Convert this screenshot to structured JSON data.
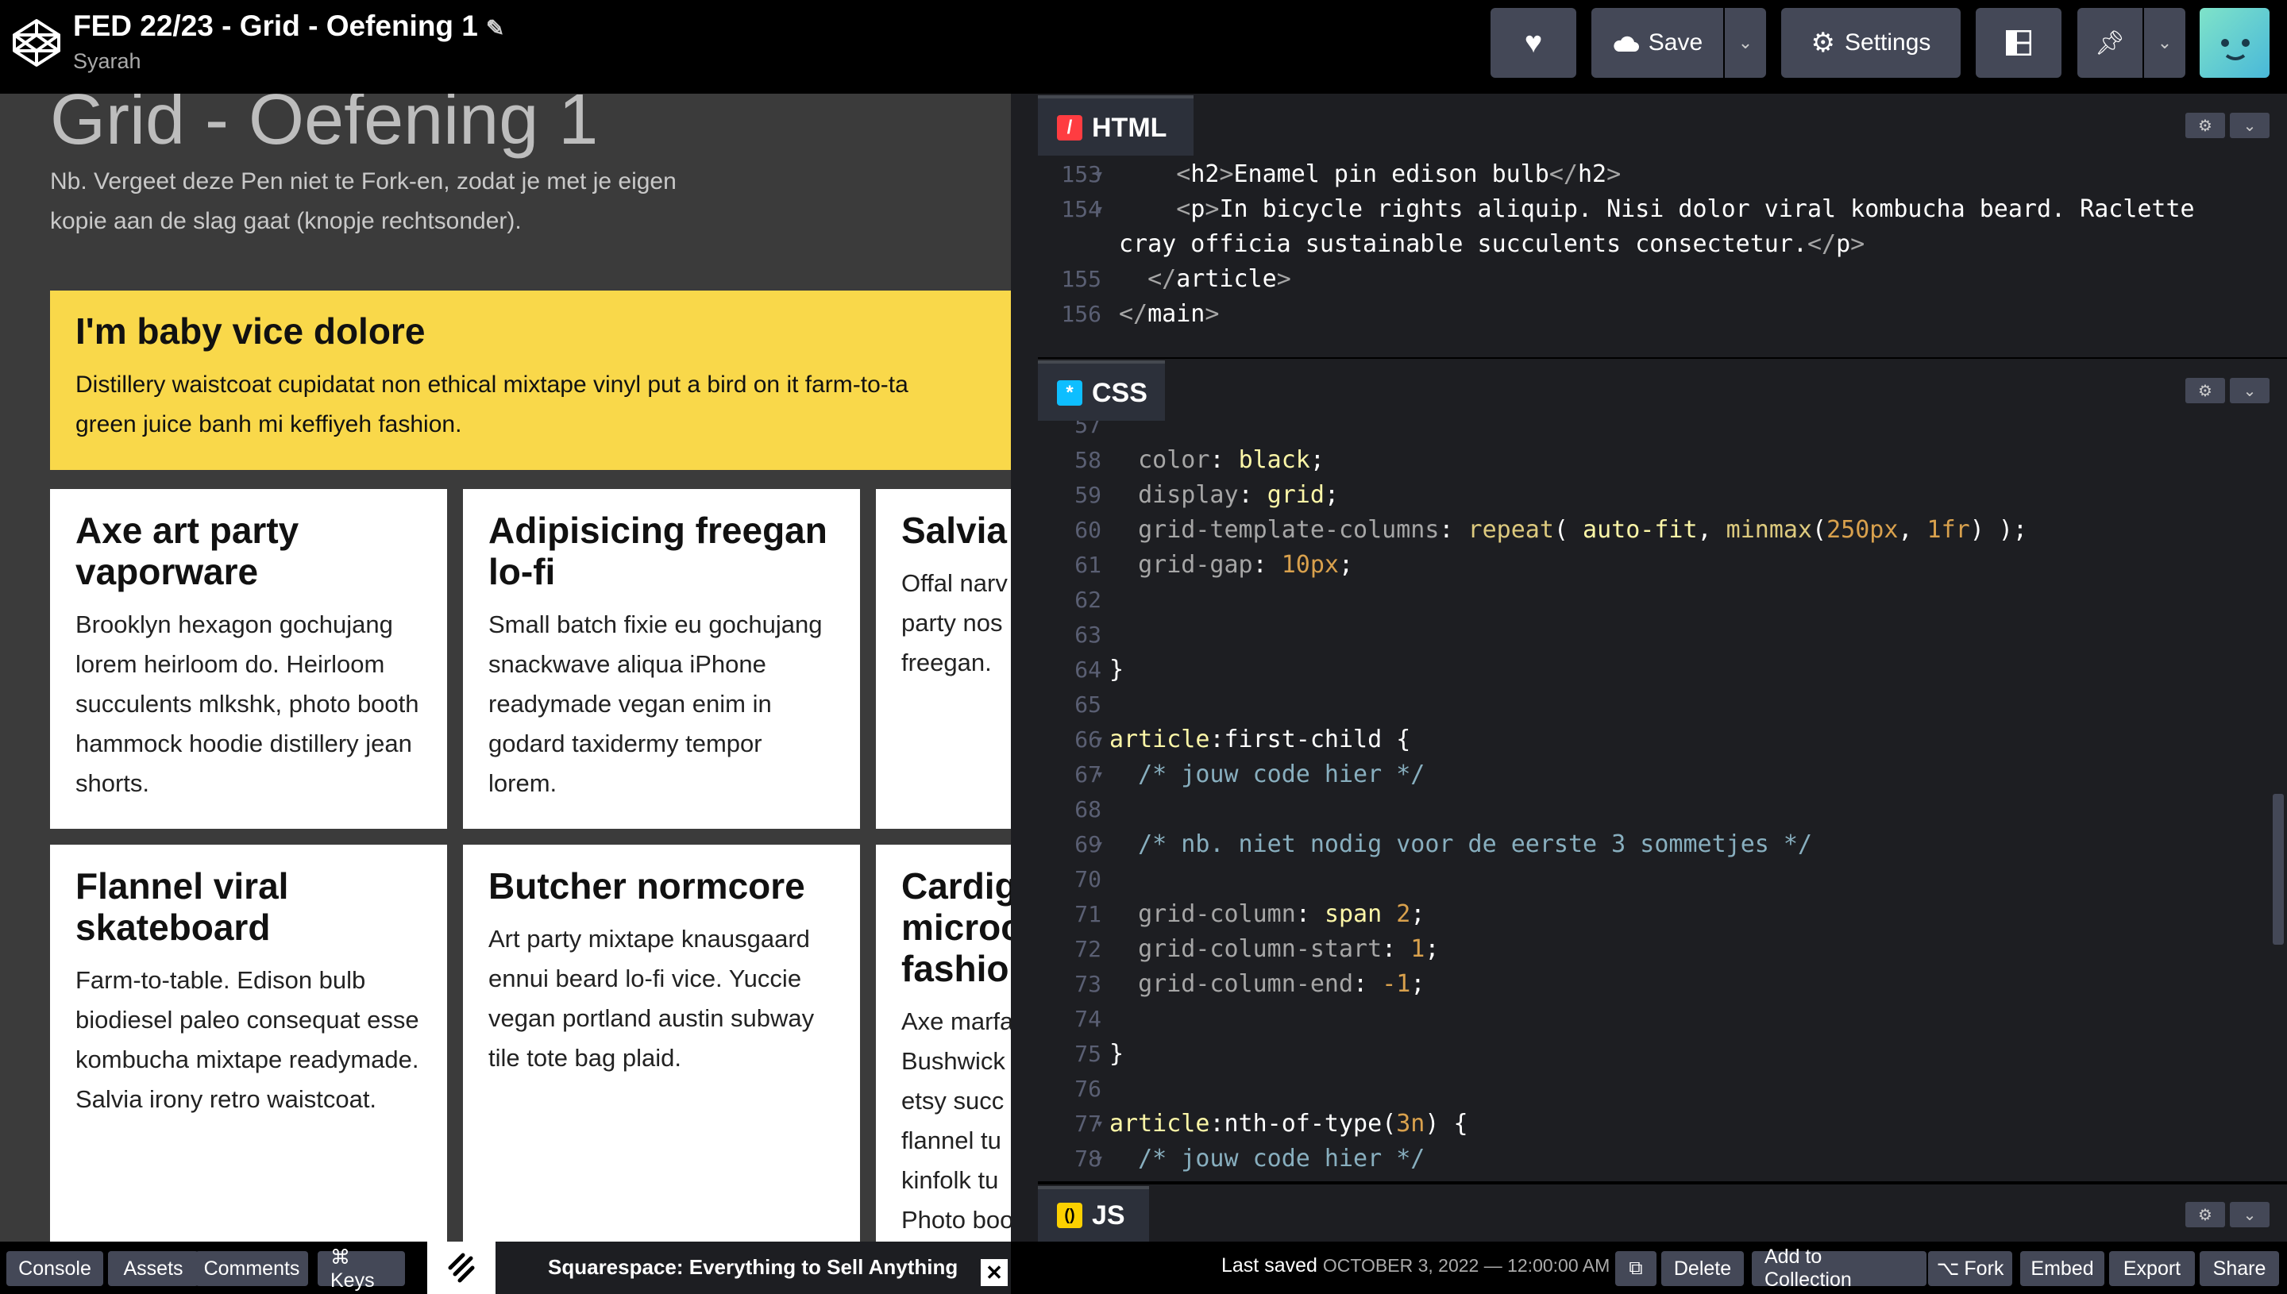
{
  "header": {
    "title": "FED 22/23 - Grid - Oefening 1",
    "author": "Syarah",
    "save_label": "Save",
    "settings_label": "Settings",
    "icons": [
      "codepen-logo-icon",
      "pencil-icon",
      "heart-icon",
      "cloud-icon",
      "chevron-down-icon",
      "gear-icon",
      "layout-icon",
      "pin-icon",
      "avatar"
    ]
  },
  "preview": {
    "heading": "Grid - Oefening 1",
    "note": "Nb. Vergeet deze Pen niet te Fork-en, zodat je met je eigen kopie aan de slag gaat (knopje rechtsonder).",
    "hero": {
      "title": "I'm baby vice dolore",
      "text1": "Distillery waistcoat cupidatat non ethical mixtape vinyl put a bird on it farm-to-ta",
      "text2": "green juice banh mi keffiyeh fashion."
    },
    "cards": [
      {
        "title": "Axe art party vaporware",
        "text": "Brooklyn hexagon gochujang lorem heirloom do. Heirloom succulents mlkshk, photo booth hammock hoodie distillery jean shorts."
      },
      {
        "title": "Adipisicing freegan lo-fi",
        "text": "Small batch fixie eu gochujang snackwave aliqua iPhone readymade vegan enim in godard taxidermy tempor lorem."
      },
      {
        "title": "Salvia",
        "text": "Offal narv party nos freegan."
      },
      {
        "title": "Flannel viral skateboard",
        "text": "Farm-to-table. Edison bulb biodiesel paleo consequat esse kombucha mixtape readymade. Salvia irony retro waistcoat."
      },
      {
        "title": "Butcher normcore",
        "text": "Art party mixtape knausgaard ennui beard lo-fi vice. Yuccie vegan portland austin subway tile tote bag plaid."
      },
      {
        "title": "Cardig microc fashio",
        "text": "Axe marfa Bushwick etsy succ flannel tu kinfolk tu Photo boo"
      }
    ]
  },
  "editor": {
    "html_tab": "HTML",
    "css_tab": "CSS",
    "js_tab": "JS",
    "html_lines": [
      {
        "n": "153",
        "fold": true,
        "indent": "    ",
        "parts": [
          [
            "tag",
            "<"
          ],
          [
            "tn",
            "h2"
          ],
          [
            "tag",
            ">"
          ],
          [
            "op",
            "Enamel pin edison bulb"
          ],
          [
            "tag",
            "</"
          ],
          [
            "tn",
            "h2"
          ],
          [
            "tag",
            ">"
          ]
        ]
      },
      {
        "n": "154",
        "fold": true,
        "indent": "    ",
        "parts": [
          [
            "tag",
            "<"
          ],
          [
            "tn",
            "p"
          ],
          [
            "tag",
            ">"
          ],
          [
            "op",
            "In bicycle rights aliquip. Nisi dolor viral kombucha beard. Raclette"
          ]
        ]
      },
      {
        "n": "",
        "fold": false,
        "indent": "",
        "parts": [
          [
            "op",
            "cray officia sustainable succulents consectetur."
          ],
          [
            "tag",
            "</"
          ],
          [
            "tn",
            "p"
          ],
          [
            "tag",
            ">"
          ]
        ]
      },
      {
        "n": "155",
        "fold": false,
        "indent": "  ",
        "parts": [
          [
            "tag",
            "</"
          ],
          [
            "tn",
            "article"
          ],
          [
            "tag",
            ">"
          ]
        ]
      },
      {
        "n": "156",
        "fold": false,
        "indent": "",
        "parts": [
          [
            "tag",
            "</"
          ],
          [
            "tn",
            "main"
          ],
          [
            "tag",
            ">"
          ]
        ]
      }
    ],
    "css_lines": [
      {
        "n": "57",
        "fold": false,
        "indent": "",
        "parts": []
      },
      {
        "n": "58",
        "fold": false,
        "indent": "  ",
        "parts": [
          [
            "prop",
            "color"
          ],
          [
            "op",
            ": "
          ],
          [
            "val",
            "black"
          ],
          [
            "op",
            ";"
          ]
        ]
      },
      {
        "n": "59",
        "fold": false,
        "indent": "  ",
        "parts": [
          [
            "prop",
            "display"
          ],
          [
            "op",
            ": "
          ],
          [
            "val",
            "grid"
          ],
          [
            "op",
            ";"
          ]
        ]
      },
      {
        "n": "60",
        "fold": false,
        "indent": "  ",
        "parts": [
          [
            "prop",
            "grid-template-columns"
          ],
          [
            "op",
            ": "
          ],
          [
            "fn",
            "repeat"
          ],
          [
            "op",
            "( "
          ],
          [
            "val",
            "auto-fit"
          ],
          [
            "op",
            ", "
          ],
          [
            "fn",
            "minmax"
          ],
          [
            "op",
            "("
          ],
          [
            "num",
            "250px"
          ],
          [
            "op",
            ", "
          ],
          [
            "num",
            "1fr"
          ],
          [
            "op",
            ") );"
          ]
        ]
      },
      {
        "n": "61",
        "fold": false,
        "indent": "  ",
        "parts": [
          [
            "prop",
            "grid-gap"
          ],
          [
            "op",
            ": "
          ],
          [
            "num",
            "10px"
          ],
          [
            "op",
            ";"
          ]
        ]
      },
      {
        "n": "62",
        "fold": false,
        "indent": "",
        "parts": []
      },
      {
        "n": "63",
        "fold": false,
        "indent": "",
        "parts": []
      },
      {
        "n": "64",
        "fold": false,
        "indent": "",
        "parts": [
          [
            "op",
            "}"
          ]
        ]
      },
      {
        "n": "65",
        "fold": false,
        "indent": "",
        "parts": []
      },
      {
        "n": "66",
        "fold": true,
        "indent": "",
        "parts": [
          [
            "sel",
            "article"
          ],
          [
            "op",
            ":"
          ],
          [
            "tn",
            "first-child"
          ],
          [
            "op",
            " {"
          ]
        ]
      },
      {
        "n": "67",
        "fold": true,
        "indent": "  ",
        "parts": [
          [
            "cm",
            "/* jouw code hier */"
          ]
        ]
      },
      {
        "n": "68",
        "fold": false,
        "indent": "",
        "parts": []
      },
      {
        "n": "69",
        "fold": true,
        "indent": "  ",
        "parts": [
          [
            "cm",
            "/* nb. niet nodig voor de eerste 3 sommetjes */"
          ]
        ]
      },
      {
        "n": "70",
        "fold": false,
        "indent": "",
        "parts": []
      },
      {
        "n": "71",
        "fold": false,
        "indent": "  ",
        "parts": [
          [
            "prop",
            "grid-column"
          ],
          [
            "op",
            ": "
          ],
          [
            "val",
            "span "
          ],
          [
            "num",
            "2"
          ],
          [
            "op",
            ";"
          ]
        ]
      },
      {
        "n": "72",
        "fold": false,
        "indent": "  ",
        "parts": [
          [
            "prop",
            "grid-column-start"
          ],
          [
            "op",
            ": "
          ],
          [
            "num",
            "1"
          ],
          [
            "op",
            ";"
          ]
        ]
      },
      {
        "n": "73",
        "fold": false,
        "indent": "  ",
        "parts": [
          [
            "prop",
            "grid-column-end"
          ],
          [
            "op",
            ": "
          ],
          [
            "num",
            "-1"
          ],
          [
            "op",
            ";"
          ]
        ]
      },
      {
        "n": "74",
        "fold": false,
        "indent": "",
        "parts": []
      },
      {
        "n": "75",
        "fold": false,
        "indent": "",
        "parts": [
          [
            "op",
            "}"
          ]
        ]
      },
      {
        "n": "76",
        "fold": false,
        "indent": "",
        "parts": []
      },
      {
        "n": "77",
        "fold": true,
        "indent": "",
        "parts": [
          [
            "sel",
            "article"
          ],
          [
            "op",
            ":"
          ],
          [
            "tn",
            "nth-of-type"
          ],
          [
            "op",
            "("
          ],
          [
            "num",
            "3n"
          ],
          [
            "op",
            ") {"
          ]
        ]
      },
      {
        "n": "78",
        "fold": true,
        "indent": "  ",
        "parts": [
          [
            "cm",
            "/* jouw code hier */"
          ]
        ]
      }
    ]
  },
  "footer": {
    "console": "Console",
    "assets": "Assets",
    "comments": "Comments",
    "keys": "⌘ Keys",
    "ad_text": "Squarespace: Everything to Sell Anything",
    "last_saved_label": "Last saved",
    "last_saved_date": "OCTOBER 3, 2022 — 12:00:00 AM",
    "delete": "Delete",
    "add_to_collection": "Add to Collection",
    "fork": "Fork",
    "embed": "Embed",
    "export": "Export",
    "share": "Share"
  },
  "colors": {
    "hero_bg": "#f9d84a",
    "html_icon": "#ff3c41",
    "css_icon": "#0ebeff",
    "js_icon": "#fcd000",
    "button_bg": "#444857"
  }
}
